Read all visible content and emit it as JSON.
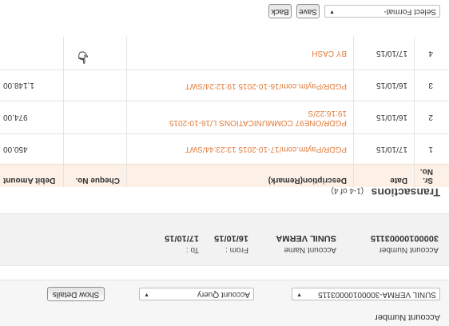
{
  "account_panel": {
    "label": "Account Number",
    "account_select_value": "SUNIL VERMA-30000100003115",
    "query_select_value": "Account Query",
    "show_details_label": "Show Details"
  },
  "summary": {
    "account_number_label": "Account Number",
    "account_number": "30000100003115",
    "account_name_label": "Account Name",
    "account_name": "SUNIL VERMA",
    "from_label": "From :",
    "from_date": "16/10/15",
    "to_label": "To :",
    "to_date": "17/10/15"
  },
  "transactions": {
    "title": "Transactions",
    "count": "(1-4 of 4)",
    "headers": {
      "sr": "Sr. No.",
      "date": "Date",
      "description": "Description(Remark)",
      "cheque": "Cheque No.",
      "debit": "Debit Amount"
    },
    "rows": [
      {
        "sr": "1",
        "date": "17/10/15",
        "desc1": "PGDR/Paytm.com/17-10-2015 13:23:44/SWT",
        "desc2": "",
        "cheque": "",
        "debit": "450.00"
      },
      {
        "sr": "2",
        "date": "16/10/15",
        "desc1": "PGDR/ONE97 COMMUNICATIONS L/16-10-2015",
        "desc2": "19:16:22/S",
        "cheque": "",
        "debit": "974.00"
      },
      {
        "sr": "3",
        "date": "16/10/15",
        "desc1": "PGDR/Paytm.com/16-10-2015 19:12:24/SWT",
        "desc2": "",
        "cheque": "",
        "debit": "1,148.00"
      },
      {
        "sr": "4",
        "date": "17/10/15",
        "desc1": "BY CASH",
        "desc2": "",
        "cheque": "",
        "debit": ""
      }
    ]
  },
  "bottom": {
    "format_select_value": "Select Format-",
    "save_label": "Save",
    "back_label": "Back"
  },
  "colors": {
    "link": "#e07b39",
    "header_bg": "#fdf0e6"
  },
  "icons": {
    "cursor": "hand-pointer-icon",
    "dropdown": "caret-down-icon"
  }
}
